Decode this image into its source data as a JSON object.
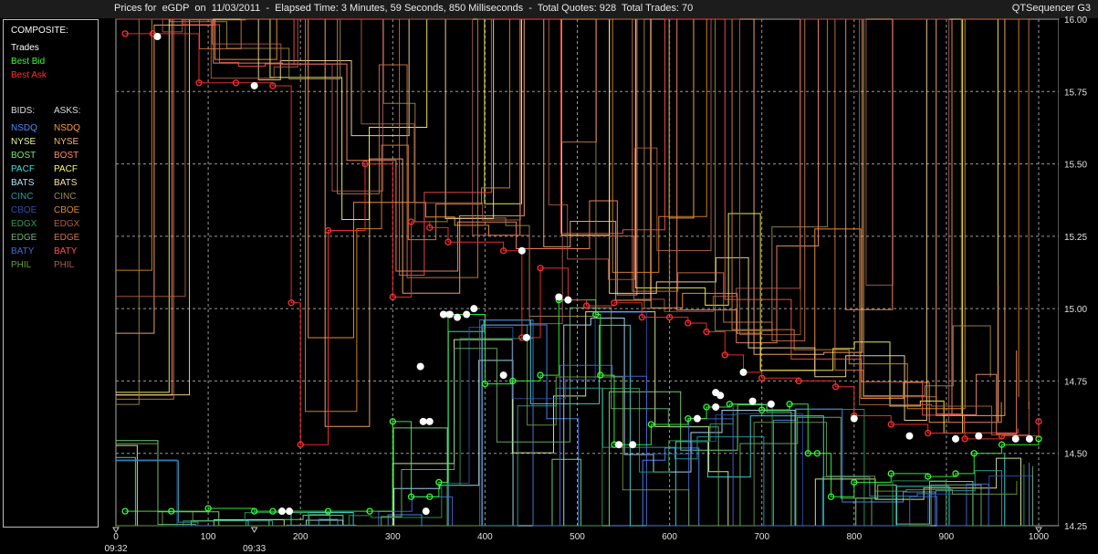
{
  "header": {
    "title": "Prices for  eGDP  on  11/03/2011  -  Elapsed Time: 3 Minutes, 59 Seconds, 850 Milliseconds  -  Total Quotes: 928  Total Trades: 70",
    "app_name": "QTSequencer G3"
  },
  "legend": {
    "composite_label": "COMPOSITE:",
    "composite": [
      {
        "label": "Trades",
        "color": "#ffffff"
      },
      {
        "label": "Best Bid",
        "color": "#33ff33"
      },
      {
        "label": "Best Ask",
        "color": "#ff3030"
      }
    ],
    "bids_label": "BIDS:",
    "asks_label": "ASKS:",
    "bids": [
      {
        "label": "NSDQ",
        "color": "#4f8cff"
      },
      {
        "label": "NYSE",
        "color": "#e6f5a0"
      },
      {
        "label": "BOST",
        "color": "#7fe07f"
      },
      {
        "label": "PACF",
        "color": "#3fe0e0"
      },
      {
        "label": "BATS",
        "color": "#b4e4ff"
      },
      {
        "label": "CINC",
        "color": "#2a9ea6"
      },
      {
        "label": "CBOE",
        "color": "#2e4fae"
      },
      {
        "label": "EDGX",
        "color": "#2f9a5a"
      },
      {
        "label": "EDGE",
        "color": "#6fb26f"
      },
      {
        "label": "BATY",
        "color": "#4a6ad8"
      },
      {
        "label": "PHIL",
        "color": "#6e9a3e"
      }
    ],
    "asks": [
      {
        "label": "NSDQ",
        "color": "#ff9a3c"
      },
      {
        "label": "NYSE",
        "color": "#ffb070"
      },
      {
        "label": "BOST",
        "color": "#ff8c6a"
      },
      {
        "label": "PACF",
        "color": "#ffff60"
      },
      {
        "label": "BATS",
        "color": "#ffe0a0"
      },
      {
        "label": "CINC",
        "color": "#a08a50"
      },
      {
        "label": "CBOE",
        "color": "#e08a2a"
      },
      {
        "label": "EDGX",
        "color": "#b06040"
      },
      {
        "label": "EDGE",
        "color": "#d07848"
      },
      {
        "label": "BATY",
        "color": "#ff5050"
      },
      {
        "label": "PHIL",
        "color": "#b05a5a"
      }
    ]
  },
  "chart_data": {
    "type": "line",
    "x_ticks": [
      "0",
      "100",
      "200",
      "300",
      "400",
      "500",
      "600",
      "700",
      "800",
      "900",
      "1000"
    ],
    "y_ticks": [
      "16.00",
      "15.75",
      "15.50",
      "15.25",
      "15.00",
      "14.75",
      "14.50",
      "14.25"
    ],
    "time_labels": [
      {
        "x": 0,
        "label": "09:32"
      },
      {
        "x": 150,
        "label": "09:33"
      }
    ],
    "xlim": [
      0,
      1000
    ],
    "ylim": [
      14.25,
      16.0
    ],
    "grid": true,
    "colors": {
      "trade": "#ffffff",
      "best_bid": "#33ff33",
      "best_ask": "#ff3030"
    },
    "series": [
      {
        "name": "Trades",
        "points": [
          [
            45,
            15.94
          ],
          [
            150,
            15.77
          ],
          [
            180,
            14.3
          ],
          [
            188,
            14.3
          ],
          [
            330,
            14.8
          ],
          [
            333,
            14.61
          ],
          [
            340,
            14.61
          ],
          [
            336,
            14.3
          ],
          [
            355,
            14.98
          ],
          [
            362,
            14.98
          ],
          [
            370,
            14.97
          ],
          [
            380,
            14.98
          ],
          [
            388,
            15.0
          ],
          [
            420,
            14.77
          ],
          [
            440,
            15.2
          ],
          [
            445,
            14.9
          ],
          [
            480,
            15.04
          ],
          [
            490,
            15.03
          ],
          [
            545,
            14.53
          ],
          [
            560,
            14.53
          ],
          [
            630,
            14.62
          ],
          [
            650,
            14.71
          ],
          [
            650,
            14.66
          ],
          [
            655,
            14.7
          ],
          [
            680,
            14.78
          ],
          [
            690,
            14.68
          ],
          [
            710,
            14.67
          ],
          [
            800,
            14.62
          ],
          [
            860,
            14.56
          ],
          [
            910,
            14.55
          ],
          [
            935,
            14.56
          ],
          [
            975,
            14.55
          ],
          [
            990,
            14.55
          ]
        ]
      },
      {
        "name": "Best Bid",
        "points": [
          [
            10,
            14.3
          ],
          [
            60,
            14.3
          ],
          [
            100,
            14.31
          ],
          [
            150,
            14.3
          ],
          [
            170,
            14.3
          ],
          [
            230,
            14.3
          ],
          [
            275,
            14.3
          ],
          [
            300,
            14.61
          ],
          [
            320,
            14.35
          ],
          [
            340,
            14.35
          ],
          [
            350,
            14.4
          ],
          [
            360,
            14.98
          ],
          [
            400,
            14.74
          ],
          [
            430,
            14.75
          ],
          [
            460,
            14.77
          ],
          [
            480,
            15.03
          ],
          [
            520,
            14.98
          ],
          [
            525,
            14.77
          ],
          [
            540,
            14.53
          ],
          [
            560,
            14.53
          ],
          [
            580,
            14.6
          ],
          [
            620,
            14.62
          ],
          [
            640,
            14.66
          ],
          [
            665,
            14.67
          ],
          [
            700,
            14.65
          ],
          [
            730,
            14.67
          ],
          [
            750,
            14.5
          ],
          [
            760,
            14.5
          ],
          [
            775,
            14.35
          ],
          [
            800,
            14.4
          ],
          [
            840,
            14.43
          ],
          [
            880,
            14.42
          ],
          [
            910,
            14.43
          ],
          [
            930,
            14.5
          ],
          [
            960,
            14.53
          ],
          [
            1000,
            14.55
          ]
        ]
      },
      {
        "name": "Best Ask",
        "points": [
          [
            10,
            15.95
          ],
          [
            40,
            15.95
          ],
          [
            90,
            15.78
          ],
          [
            130,
            15.78
          ],
          [
            170,
            15.77
          ],
          [
            190,
            15.02
          ],
          [
            200,
            14.53
          ],
          [
            230,
            15.27
          ],
          [
            270,
            15.5
          ],
          [
            300,
            15.04
          ],
          [
            320,
            15.3
          ],
          [
            340,
            15.28
          ],
          [
            360,
            15.23
          ],
          [
            420,
            15.2
          ],
          [
            440,
            14.9
          ],
          [
            460,
            15.14
          ],
          [
            490,
            15.03
          ],
          [
            510,
            15.01
          ],
          [
            540,
            15.02
          ],
          [
            570,
            14.97
          ],
          [
            600,
            14.97
          ],
          [
            620,
            14.95
          ],
          [
            640,
            14.92
          ],
          [
            660,
            14.84
          ],
          [
            680,
            14.78
          ],
          [
            700,
            14.76
          ],
          [
            740,
            14.75
          ],
          [
            780,
            14.73
          ],
          [
            800,
            14.63
          ],
          [
            840,
            14.6
          ],
          [
            880,
            14.57
          ],
          [
            920,
            14.55
          ],
          [
            960,
            14.56
          ],
          [
            1000,
            14.61
          ]
        ]
      }
    ]
  }
}
